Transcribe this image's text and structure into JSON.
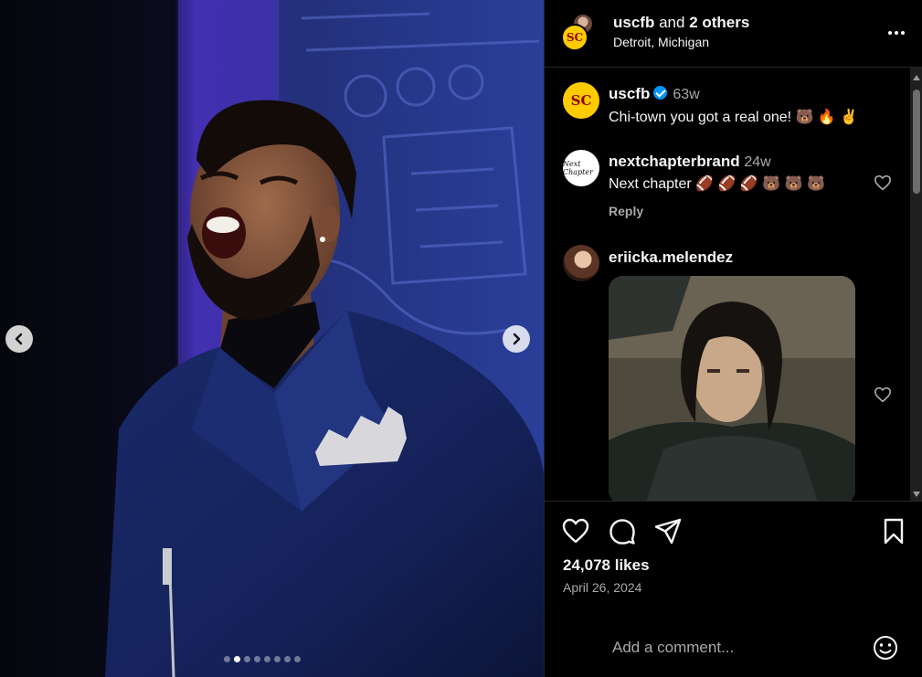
{
  "header": {
    "username": "uscfb",
    "and_text": "and",
    "others": "2 others",
    "location": "Detroit, Michigan",
    "avatar_text": "SC"
  },
  "caption": {
    "username": "uscfb",
    "time": "63w",
    "text": "Chi-town you got a real one! 🐻 🔥 ✌️",
    "avatar_text": "SC"
  },
  "comments": [
    {
      "username": "nextchapterbrand",
      "time": "24w",
      "text": "Next chapter 🏈 🏈 🏈 🐻 🐻 🐻",
      "reply_label": "Reply",
      "avatar_text": "Next Chapter"
    },
    {
      "username": "eriicka.melendez"
    }
  ],
  "post": {
    "likes": "24,078 likes",
    "date": "April 26, 2024"
  },
  "composer": {
    "placeholder": "Add a comment..."
  },
  "carousel": {
    "slide_count": 8,
    "active_index": 1
  },
  "colors": {
    "background": "#000000",
    "accent_blue": "#0095f6",
    "usc_gold": "#ffcc00",
    "usc_cardinal": "#990000",
    "muted_text": "#a8a8a8"
  },
  "icons": {
    "prev": "chevron-left-icon",
    "next": "chevron-right-icon",
    "more": "more-options-icon",
    "like": "heart-icon",
    "comment": "comment-icon",
    "share": "share-icon",
    "save": "bookmark-icon",
    "emoji": "emoji-icon",
    "verified": "verified-badge-icon"
  }
}
